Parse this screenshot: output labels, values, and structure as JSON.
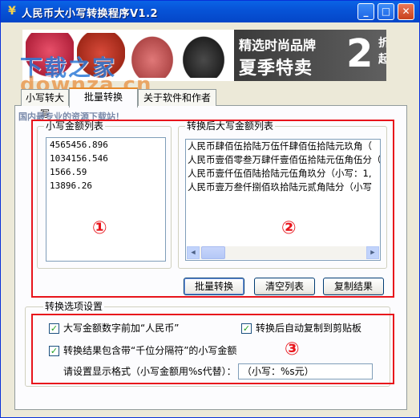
{
  "window": {
    "title": "人民币大小写转换程序V1.2",
    "buttons": {
      "minimize": "_",
      "maximize": "□",
      "close": "✕"
    }
  },
  "banner": {
    "headline": "精选时尚品牌",
    "slogan": "夏季特卖",
    "big_number": "2",
    "discount_suffix": "折起"
  },
  "watermark": {
    "brand": "下载之家",
    "domain": "downza.cn",
    "tagline": "国内最专业的资源下载站！"
  },
  "tabs": [
    {
      "label": "小写转大写"
    },
    {
      "label": "批量转换"
    },
    {
      "label": "关于软件和作者"
    }
  ],
  "left_group": {
    "title": "小写金额列表",
    "items": [
      "4565456.896",
      "1034156.546",
      "1566.59",
      "13896.26"
    ]
  },
  "right_group": {
    "title": "转换后大写金额列表",
    "items": [
      "人民币肆佰伍拾陆万伍仟肆佰伍拾陆元玖角（",
      "人民币壹佰零叁万肆仟壹佰伍拾陆元伍角伍分（",
      "人民币壹仟伍佰陆拾陆元伍角玖分（小写：1,",
      "人民币壹万叁仟捌佰玖拾陆元贰角陆分（小写"
    ]
  },
  "actions": {
    "batch_convert": "批量转换",
    "clear_list": "清空列表",
    "copy_result": "复制结果"
  },
  "options": {
    "title": "转换选项设置",
    "prefix_rmb": {
      "label": "大写金额数字前加“人民币”",
      "checked": true
    },
    "auto_copy": {
      "label": "转换后自动复制到剪贴板",
      "checked": true
    },
    "include_separator": {
      "label": "转换结果包含带“千位分隔符”的小写金额",
      "checked": true
    },
    "format_label": "请设置显示格式（小写金额用%s代替）：",
    "format_value": "（小写：%s元）"
  },
  "annotations": {
    "one": "①",
    "two": "②",
    "three": "③"
  },
  "colors": {
    "title_bar": "#0A64E6",
    "annotation_red": "#E8141B",
    "tab_active": "#E68B2C"
  }
}
